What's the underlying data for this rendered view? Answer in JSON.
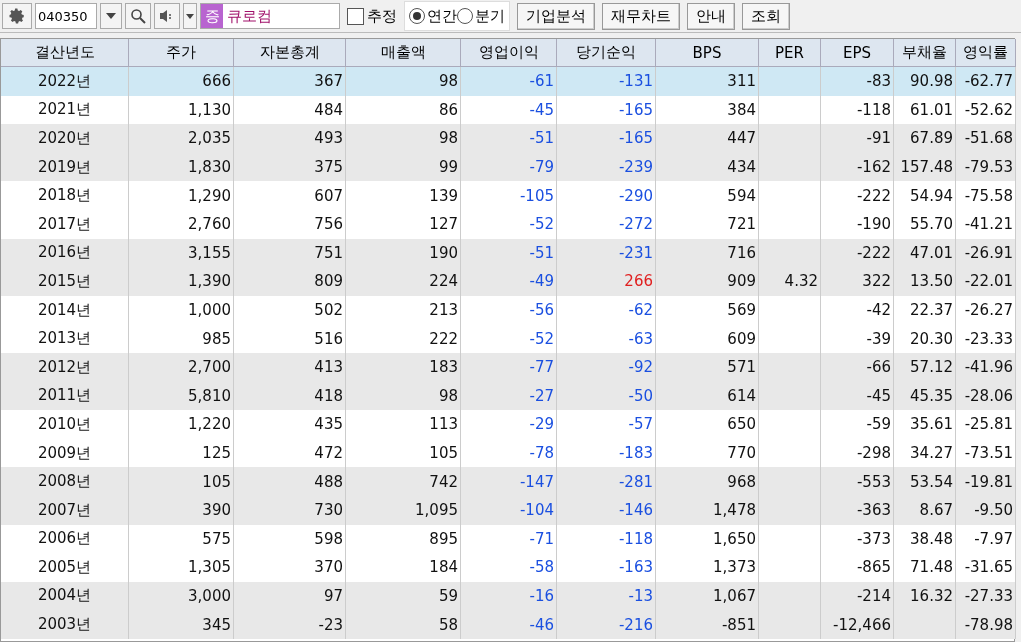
{
  "toolbar": {
    "code": "040350",
    "market_badge": "증",
    "company": "큐로컴",
    "estimate": {
      "label": "추정",
      "checked": false
    },
    "period": [
      {
        "label": "연간",
        "selected": true
      },
      {
        "label": "분기",
        "selected": false
      }
    ],
    "buttons": [
      "기업분석",
      "재무차트",
      "안내",
      "조회"
    ]
  },
  "table": {
    "columns": [
      "결산년도",
      "주가",
      "자본총계",
      "매출액",
      "영업이익",
      "당기순익",
      "BPS",
      "PER",
      "EPS",
      "부채율",
      "영익률"
    ],
    "rows": [
      {
        "selected": true,
        "cells": [
          "2022년",
          "666",
          "367",
          "98",
          "-61",
          "-131",
          "311",
          "",
          "-83",
          "90.98",
          "-62.77"
        ]
      },
      {
        "selected": false,
        "cells": [
          "2021년",
          "1,130",
          "484",
          "86",
          "-45",
          "-165",
          "384",
          "",
          "-118",
          "61.01",
          "-52.62"
        ]
      },
      {
        "selected": false,
        "cells": [
          "2020년",
          "2,035",
          "493",
          "98",
          "-51",
          "-165",
          "447",
          "",
          "-91",
          "67.89",
          "-51.68"
        ]
      },
      {
        "selected": false,
        "cells": [
          "2019년",
          "1,830",
          "375",
          "99",
          "-79",
          "-239",
          "434",
          "",
          "-162",
          "157.48",
          "-79.53"
        ]
      },
      {
        "selected": false,
        "cells": [
          "2018년",
          "1,290",
          "607",
          "139",
          "-105",
          "-290",
          "594",
          "",
          "-222",
          "54.94",
          "-75.58"
        ]
      },
      {
        "selected": false,
        "cells": [
          "2017년",
          "2,760",
          "756",
          "127",
          "-52",
          "-272",
          "721",
          "",
          "-190",
          "55.70",
          "-41.21"
        ]
      },
      {
        "selected": false,
        "cells": [
          "2016년",
          "3,155",
          "751",
          "190",
          "-51",
          "-231",
          "716",
          "",
          "-222",
          "47.01",
          "-26.91"
        ]
      },
      {
        "selected": false,
        "cells": [
          "2015년",
          "1,390",
          "809",
          "224",
          "-49",
          "266",
          "909",
          "4.32",
          "322",
          "13.50",
          "-22.01"
        ]
      },
      {
        "selected": false,
        "cells": [
          "2014년",
          "1,000",
          "502",
          "213",
          "-56",
          "-62",
          "569",
          "",
          "-42",
          "22.37",
          "-26.27"
        ]
      },
      {
        "selected": false,
        "cells": [
          "2013년",
          "985",
          "516",
          "222",
          "-52",
          "-63",
          "609",
          "",
          "-39",
          "20.30",
          "-23.33"
        ]
      },
      {
        "selected": false,
        "cells": [
          "2012년",
          "2,700",
          "413",
          "183",
          "-77",
          "-92",
          "571",
          "",
          "-66",
          "57.12",
          "-41.96"
        ]
      },
      {
        "selected": false,
        "cells": [
          "2011년",
          "5,810",
          "418",
          "98",
          "-27",
          "-50",
          "614",
          "",
          "-45",
          "45.35",
          "-28.06"
        ]
      },
      {
        "selected": false,
        "cells": [
          "2010년",
          "1,220",
          "435",
          "113",
          "-29",
          "-57",
          "650",
          "",
          "-59",
          "35.61",
          "-25.81"
        ]
      },
      {
        "selected": false,
        "cells": [
          "2009년",
          "125",
          "472",
          "105",
          "-78",
          "-183",
          "770",
          "",
          "-298",
          "34.27",
          "-73.51"
        ]
      },
      {
        "selected": false,
        "cells": [
          "2008년",
          "105",
          "488",
          "742",
          "-147",
          "-281",
          "968",
          "",
          "-553",
          "53.54",
          "-19.81"
        ]
      },
      {
        "selected": false,
        "cells": [
          "2007년",
          "390",
          "730",
          "1,095",
          "-104",
          "-146",
          "1,478",
          "",
          "-363",
          "8.67",
          "-9.50"
        ]
      },
      {
        "selected": false,
        "cells": [
          "2006년",
          "575",
          "598",
          "895",
          "-71",
          "-118",
          "1,650",
          "",
          "-373",
          "38.48",
          "-7.97"
        ]
      },
      {
        "selected": false,
        "cells": [
          "2005년",
          "1,305",
          "370",
          "184",
          "-58",
          "-163",
          "1,373",
          "",
          "-865",
          "71.48",
          "-31.65"
        ]
      },
      {
        "selected": false,
        "cells": [
          "2004년",
          "3,000",
          "97",
          "59",
          "-16",
          "-13",
          "1,067",
          "",
          "-214",
          "16.32",
          "-27.33"
        ]
      },
      {
        "selected": false,
        "cells": [
          "2003년",
          "345",
          "-23",
          "58",
          "-46",
          "-216",
          "-851",
          "",
          "-12,466",
          "",
          "-78.98"
        ]
      }
    ]
  }
}
